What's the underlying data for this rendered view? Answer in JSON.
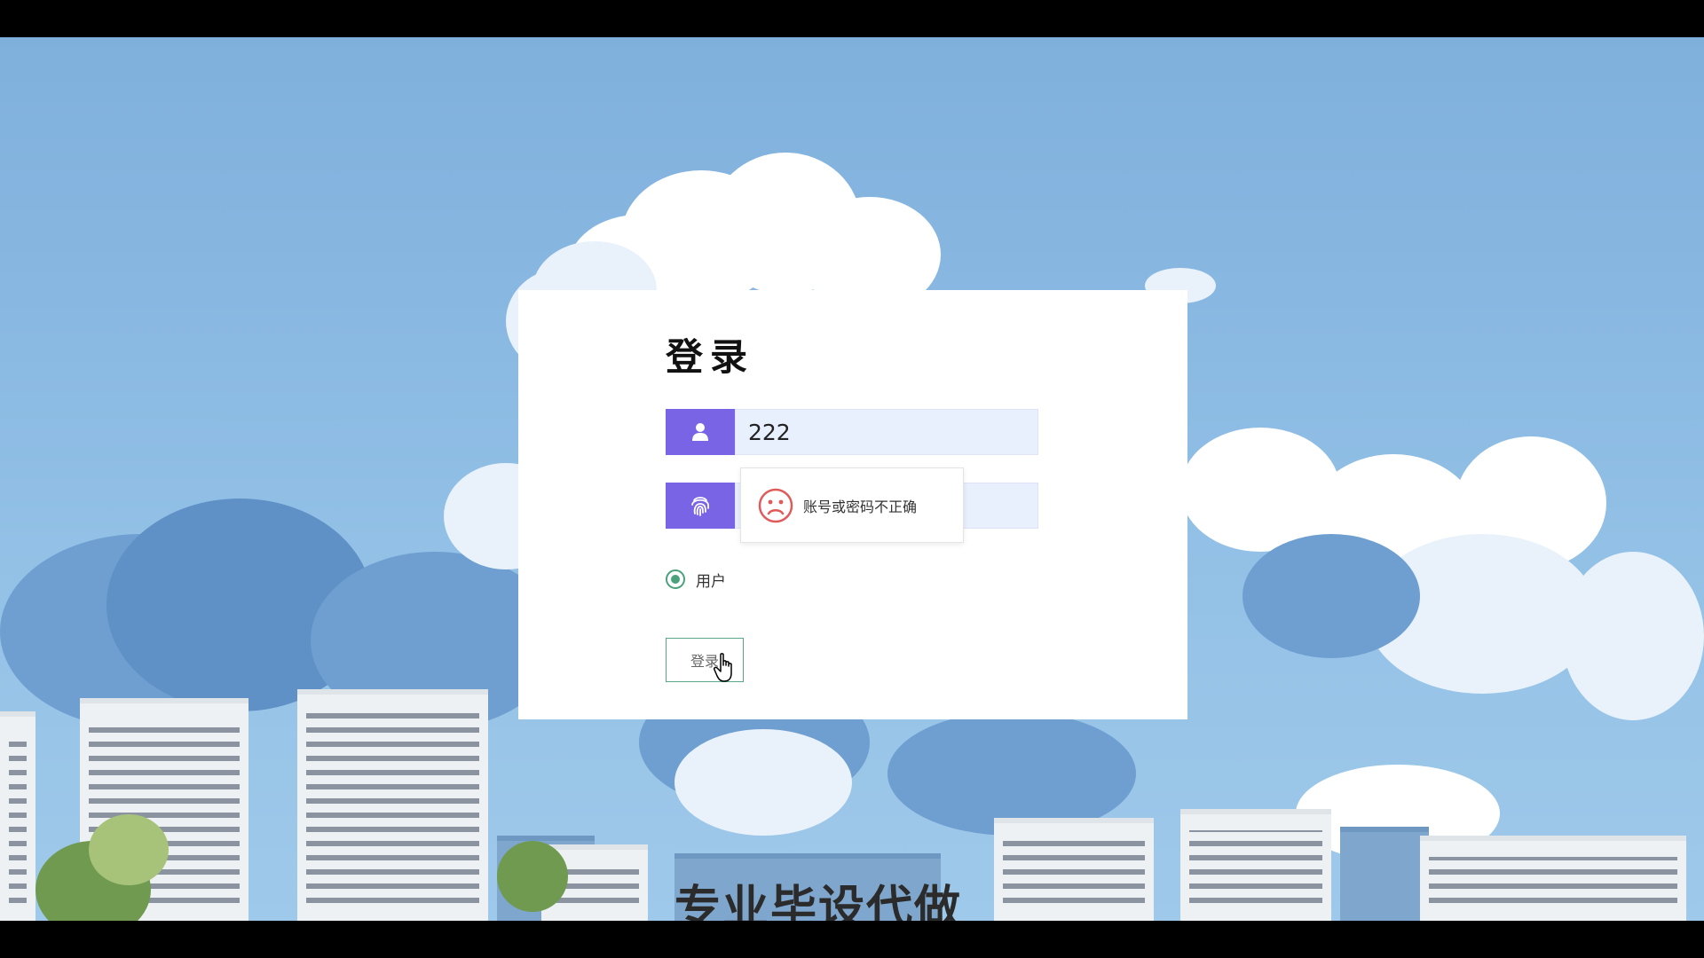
{
  "login": {
    "title": "登录",
    "username_value": "222",
    "password_value": "",
    "role_label": "用户",
    "role_selected": true,
    "submit_label": "登录"
  },
  "toast": {
    "message": "账号或密码不正确",
    "icon": "sad-face-icon"
  },
  "background": {
    "bottom_text": "专业毕设代做"
  },
  "icons": {
    "username": "user-icon",
    "password": "fingerprint-icon",
    "cursor": "hand-pointer-icon"
  },
  "colors": {
    "icon_accent": "#7a64e6",
    "input_bg": "#e8effd",
    "radio_green": "#4aa27c",
    "button_border": "#5aa88a",
    "error_red": "#e05a5a"
  }
}
